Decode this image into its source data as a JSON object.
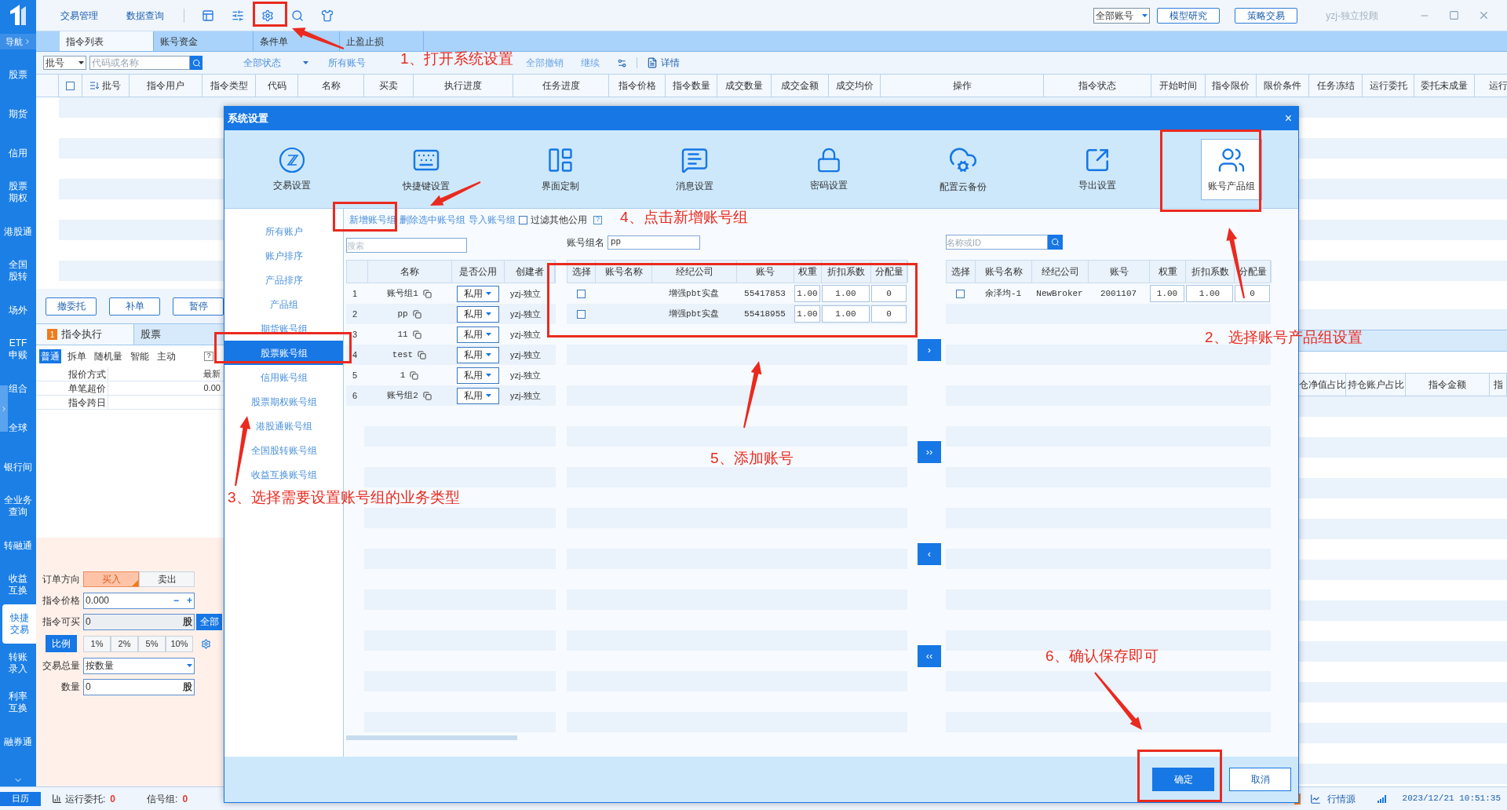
{
  "sidebar": {
    "nav_toggle": "导航",
    "items": [
      {
        "lines": [
          "股票"
        ],
        "selected": false
      },
      {
        "lines": [
          "期货"
        ],
        "selected": false
      },
      {
        "lines": [
          "信用"
        ],
        "selected": false
      },
      {
        "lines": [
          "股票",
          "期权"
        ],
        "selected": false
      },
      {
        "lines": [
          "港股通"
        ],
        "selected": false
      },
      {
        "lines": [
          "全国",
          "股转"
        ],
        "selected": false
      },
      {
        "lines": [
          "场外"
        ],
        "selected": false
      },
      {
        "lines": [
          "ETF",
          "申赎"
        ],
        "selected": false
      },
      {
        "lines": [
          "组合"
        ],
        "selected": false
      },
      {
        "lines": [
          "全球"
        ],
        "selected": false
      },
      {
        "lines": [
          "银行间"
        ],
        "selected": false
      },
      {
        "lines": [
          "全业务",
          "查询"
        ],
        "selected": false
      },
      {
        "lines": [
          "转融通"
        ],
        "selected": false
      },
      {
        "lines": [
          "收益",
          "互换"
        ],
        "selected": false
      },
      {
        "lines": [
          "快捷",
          "交易"
        ],
        "selected": true
      },
      {
        "lines": [
          "转账",
          "录入"
        ],
        "selected": false
      },
      {
        "lines": [
          "利率",
          "互换"
        ],
        "selected": false
      },
      {
        "lines": [
          "融券通"
        ],
        "selected": false
      }
    ]
  },
  "menu": [
    "交易管理",
    "数据查询"
  ],
  "top_right": {
    "account_select": "全部账号",
    "buttons": [
      "模型研究",
      "策略交易"
    ],
    "user": "yzj-独立投顾"
  },
  "tabs": [
    {
      "label": "指令列表",
      "selected": true
    },
    {
      "label": "账号资金",
      "selected": false
    },
    {
      "label": "条件单",
      "selected": false
    },
    {
      "label": "止盈止损",
      "selected": false
    }
  ],
  "filter": {
    "batch_select": "批号",
    "search_placeholder": "代码或名称",
    "status_filter": "全部状态",
    "account_filter": "所有账号",
    "actions": [
      "全部撤销",
      "继续"
    ],
    "detail": "详情"
  },
  "orders_table": {
    "header_checked": false,
    "columns": [
      "批号",
      "指令用户",
      "指令类型",
      "代码",
      "名称",
      "买卖",
      "执行进度",
      "任务进度",
      "指令价格",
      "指令数量",
      "成交数量",
      "成交金额",
      "成交均价",
      "操作",
      "指令状态",
      "开始时间",
      "指令限价",
      "限价条件",
      "任务冻结",
      "运行委托",
      "委托未成量",
      "运行"
    ]
  },
  "action_buttons": [
    "撤委托",
    "补单",
    "暂停"
  ],
  "exec_panel": {
    "badge": "1",
    "title": "指令执行",
    "market": "股票",
    "modes": [
      {
        "label": "普通",
        "selected": true
      },
      {
        "label": "拆单",
        "selected": false
      },
      {
        "label": "随机量",
        "selected": false
      },
      {
        "label": "智能",
        "selected": false
      },
      {
        "label": "主动",
        "selected": false
      }
    ],
    "help": "?",
    "params": [
      {
        "label": "报价方式",
        "value": "最新"
      },
      {
        "label": "单笔超价",
        "value": "0.00"
      },
      {
        "label": "指令跨日"
      }
    ]
  },
  "order_form": {
    "direction_label": "订单方向",
    "directions": [
      {
        "label": "买入",
        "selected": true
      },
      {
        "label": "卖出",
        "selected": false
      }
    ],
    "price_label": "指令价格",
    "price": "0.000",
    "minus": "−",
    "plus": "+",
    "buyable_label": "指令可买",
    "buyable": "0",
    "unit": "股",
    "all_button": "全部",
    "ratio_button": "比例",
    "ratios": [
      "1%",
      "2%",
      "5%",
      "10%"
    ],
    "total_label": "交易总量",
    "total_mode": "按数量",
    "qty_label": "数量",
    "qty": "0",
    "qty_unit": "股"
  },
  "positions_header": [
    "仓净值占比",
    "持仓账户占比",
    "指令金额",
    "指"
  ],
  "status_bar": {
    "calendar": "日历",
    "running_label": "运行委托:",
    "running": "0",
    "signal_label": "信号组:",
    "signal": "0",
    "quote_source": "行情源",
    "time": "2023/12/21 10:51:35"
  },
  "dialog": {
    "title": "系统设置",
    "close": "×",
    "toolbar": [
      {
        "label": "交易设置",
        "selected": false
      },
      {
        "label": "快捷键设置",
        "selected": false
      },
      {
        "label": "界面定制",
        "selected": false
      },
      {
        "label": "消息设置",
        "selected": false
      },
      {
        "label": "密码设置",
        "selected": false
      },
      {
        "label": "配置云备份",
        "selected": false
      },
      {
        "label": "导出设置",
        "selected": false
      },
      {
        "label": "账号产品组",
        "selected": true
      }
    ],
    "nav": [
      {
        "label": "所有账户",
        "selected": false
      },
      {
        "label": "账户排序",
        "selected": false
      },
      {
        "label": "产品排序",
        "selected": false
      },
      {
        "label": "产品组",
        "selected": false
      },
      {
        "label": "期货账号组",
        "selected": false
      },
      {
        "label": "股票账号组",
        "selected": true
      },
      {
        "label": "信用账号组",
        "selected": false
      },
      {
        "label": "股票期权账号组",
        "selected": false
      },
      {
        "label": "港股通账号组",
        "selected": false
      },
      {
        "label": "全国股转账号组",
        "selected": false
      },
      {
        "label": "收益互换账号组",
        "selected": false
      }
    ],
    "links": [
      "新增账号组",
      "删除选中账号组",
      "导入账号组"
    ],
    "filter_checkbox": {
      "label": "过滤其他公用",
      "checked": false
    },
    "help": "?",
    "group_search_placeholder": "搜索",
    "groups_table": {
      "columns": [
        "名称",
        "是否公用",
        "创建者"
      ],
      "rows": [
        {
          "index": "1",
          "name": "账号组1",
          "share": "私用",
          "creator": "yzj-独立"
        },
        {
          "index": "2",
          "name": "pp",
          "share": "私用",
          "creator": "yzj-独立"
        },
        {
          "index": "3",
          "name": "11",
          "share": "私用",
          "creator": "yzj-独立"
        },
        {
          "index": "4",
          "name": "test",
          "share": "私用",
          "creator": "yzj-独立"
        },
        {
          "index": "5",
          "name": "1",
          "share": "私用",
          "creator": "yzj-独立"
        },
        {
          "index": "6",
          "name": "账号组2",
          "share": "私用",
          "creator": "yzj-独立"
        }
      ]
    },
    "group_name_label": "账号组名",
    "group_name": "pp",
    "members_table": {
      "columns": [
        "选择",
        "账号名称",
        "经纪公司",
        "账号",
        "权重",
        "折扣系数",
        "分配量"
      ],
      "rows": [
        {
          "checked": false,
          "broker": "增强pbt实盘",
          "account": "55417853",
          "weight": "1.00",
          "discount": "1.00",
          "allocation": "0"
        },
        {
          "checked": false,
          "broker": "增强pbt实盘",
          "account": "55418955",
          "weight": "1.00",
          "discount": "1.00",
          "allocation": "0"
        }
      ]
    },
    "move_buttons": [
      "›",
      "››",
      "‹",
      "‹‹"
    ],
    "available_search_placeholder": "名称或ID",
    "available_table": {
      "columns": [
        "选择",
        "账号名称",
        "经纪公司",
        "账号",
        "权重",
        "折扣系数",
        "分配量"
      ],
      "rows": [
        {
          "checked": false,
          "account_name": "余泽均-1",
          "broker": "NewBroker",
          "account": "2001107",
          "weight": "1.00",
          "discount": "1.00",
          "allocation": "0"
        }
      ]
    },
    "buttons": [
      {
        "label": "确定",
        "kind": "primary"
      },
      {
        "label": "取消",
        "kind": "secondary"
      }
    ]
  },
  "annotations": [
    "1、打开系统设置",
    "2、选择账号产品组设置",
    "3、选择需要设置账号组的业务类型",
    "4、点击新增账号组",
    "5、添加账号",
    "6、确认保存即可"
  ]
}
